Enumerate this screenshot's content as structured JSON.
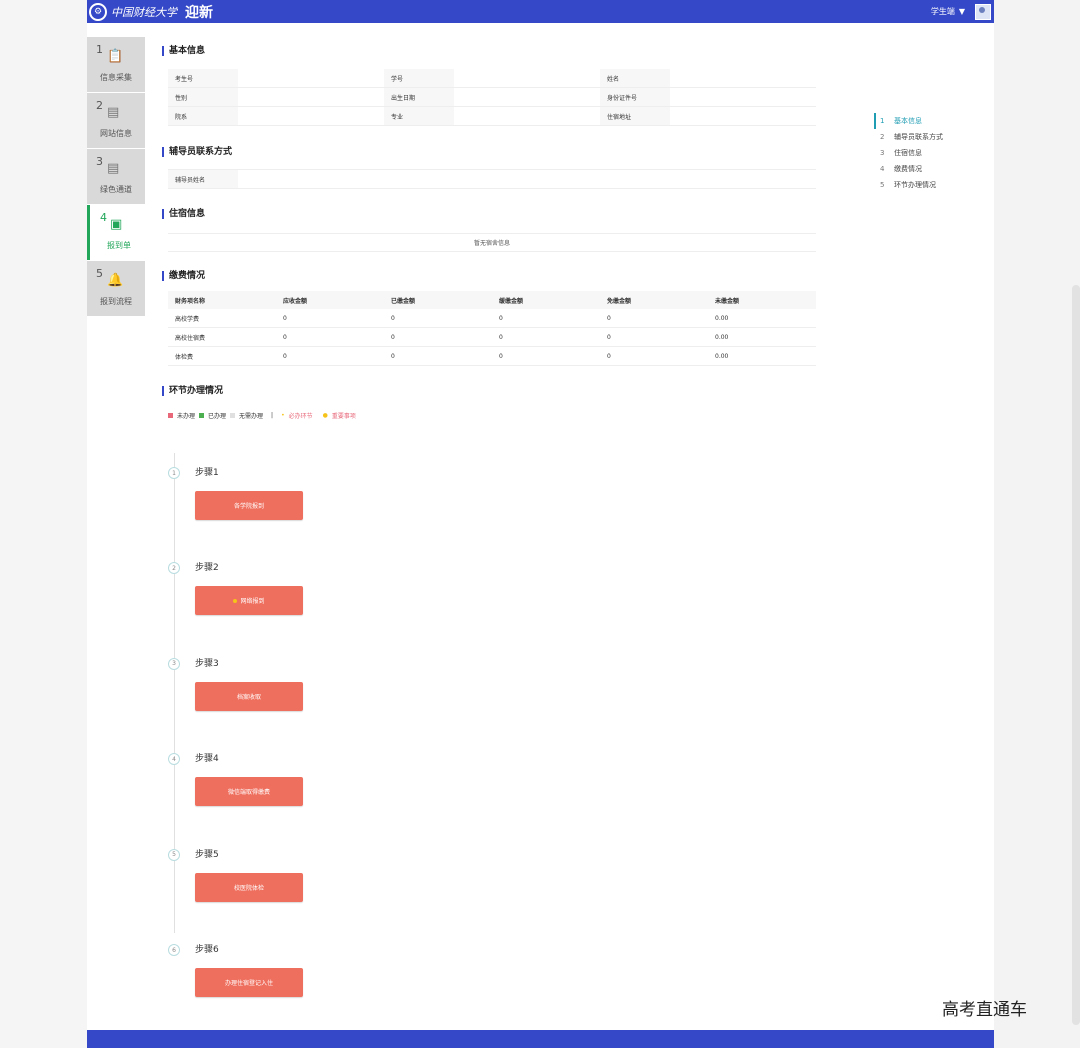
{
  "header": {
    "logo_mark": "⚙",
    "logo_text": "中国财经大学",
    "app_title": "迎新",
    "user_name": "学生端",
    "caret_icon": "▼"
  },
  "steps": [
    {
      "num": "1",
      "label": "信息采集",
      "icon": "clipboard-icon",
      "glyph": "📋"
    },
    {
      "num": "2",
      "label": "网站信息",
      "icon": "calendar-icon",
      "glyph": "▤"
    },
    {
      "num": "3",
      "label": "绿色通道",
      "icon": "calendar-icon",
      "glyph": "▤"
    },
    {
      "num": "4",
      "label": "报到单",
      "icon": "id-card-icon",
      "glyph": "▣"
    },
    {
      "num": "5",
      "label": "报到流程",
      "icon": "bell-icon",
      "glyph": "🔔"
    }
  ],
  "sections": {
    "basic": "基本信息",
    "teacher": "辅导员联系方式",
    "dorm": "住宿信息",
    "fee": "缴费情况",
    "process": "环节办理情况"
  },
  "basic_info": {
    "rows": [
      [
        "考生号",
        "",
        "学号",
        "",
        "姓名",
        ""
      ],
      [
        "性别",
        "",
        "出生日期",
        "",
        "身份证件号",
        ""
      ],
      [
        "院系",
        "",
        "专业",
        "",
        "住宿地址",
        ""
      ]
    ]
  },
  "teacher_info": {
    "label": "辅导员姓名",
    "value": ""
  },
  "dorm_info": {
    "empty_text": "暂无宿舍信息"
  },
  "fee_table": {
    "headers": [
      "财务项名称",
      "应收金额",
      "已缴金额",
      "缓缴金额",
      "免缴金额",
      "未缴金额"
    ],
    "rows": [
      [
        "高校学费",
        "0",
        "0",
        "0",
        "0",
        "0.00"
      ],
      [
        "高校住宿费",
        "0",
        "0",
        "0",
        "0",
        "0.00"
      ],
      [
        "体检费",
        "0",
        "0",
        "0",
        "0",
        "0.00"
      ]
    ]
  },
  "legend": {
    "items": [
      {
        "label": "未办理",
        "color": "#e8687a"
      },
      {
        "label": "已办理",
        "color": "#4caf50"
      },
      {
        "label": "无需办理",
        "color": "#e0e0e0"
      }
    ],
    "separator": "|",
    "required": "必办环节",
    "required_color": "#f5c31a",
    "important": "重要事项",
    "important_color": "#f5c31a"
  },
  "process_steps": [
    {
      "circle": "1",
      "title": "步骤1",
      "button": "各学院报到",
      "marked": false
    },
    {
      "circle": "2",
      "title": "步骤2",
      "button": "网络报到",
      "marked": true
    },
    {
      "circle": "3",
      "title": "步骤3",
      "button": "档案收取",
      "marked": false
    },
    {
      "circle": "4",
      "title": "步骤4",
      "button": "微信端取得缴费",
      "marked": false
    },
    {
      "circle": "5",
      "title": "步骤5",
      "button": "校医院体检",
      "marked": false
    },
    {
      "circle": "6",
      "title": "步骤6",
      "button": "办理住宿登记入住",
      "marked": false
    }
  ],
  "anchor_nav": [
    {
      "num": "1",
      "label": "基本信息",
      "active": true
    },
    {
      "num": "2",
      "label": "辅导员联系方式",
      "active": false
    },
    {
      "num": "3",
      "label": "住宿信息",
      "active": false
    },
    {
      "num": "4",
      "label": "缴费情况",
      "active": false
    },
    {
      "num": "5",
      "label": "环节办理情况",
      "active": false
    }
  ],
  "watermark": "高考直通车",
  "colors": {
    "brand": "#3548c7",
    "accent_green": "#21a65a",
    "button": "#ef6f5e",
    "anchor_active": "#1f9db3"
  }
}
